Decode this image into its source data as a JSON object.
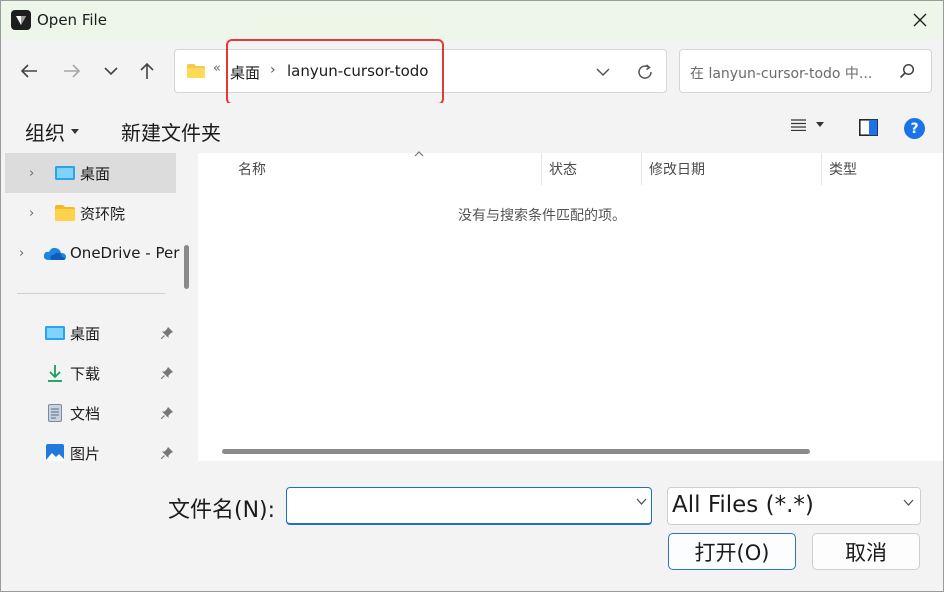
{
  "window": {
    "title": "Open File",
    "close_icon": "close-icon"
  },
  "nav": {
    "back_icon": "arrow-left-icon",
    "forward_icon": "arrow-right-icon",
    "recent_icon": "chevron-down-icon",
    "up_icon": "arrow-up-icon"
  },
  "address": {
    "overflow": "«",
    "crumbs": [
      "桌面",
      "lanyun-cursor-todo"
    ],
    "separator": "›"
  },
  "search": {
    "placeholder": "在 lanyun-cursor-todo 中..."
  },
  "commands": {
    "organize": "组织",
    "new_folder": "新建文件夹"
  },
  "sidebar": {
    "tree": [
      {
        "label": "桌面",
        "icon": "desktop-folder-icon",
        "selected": true
      },
      {
        "label": "资环院",
        "icon": "folder-icon",
        "selected": false
      },
      {
        "label": "OneDrive - Per",
        "icon": "onedrive-cloud-icon",
        "selected": false
      }
    ],
    "quick_access": [
      {
        "label": "桌面",
        "icon": "desktop-folder-icon"
      },
      {
        "label": "下载",
        "icon": "download-icon"
      },
      {
        "label": "文档",
        "icon": "document-icon"
      },
      {
        "label": "图片",
        "icon": "picture-icon"
      }
    ]
  },
  "file_list": {
    "columns": [
      "名称",
      "状态",
      "修改日期",
      "类型"
    ],
    "empty_message": "没有与搜索条件匹配的项。"
  },
  "bottom": {
    "filename_label": "文件名(N):",
    "filename_value": "",
    "filetype": "All Files (*.*)",
    "open_button": "打开(O)",
    "cancel_button": "取消"
  },
  "colors": {
    "accent": "#1a6fd1",
    "highlight": "#e53935",
    "help": "#1a73e8"
  }
}
